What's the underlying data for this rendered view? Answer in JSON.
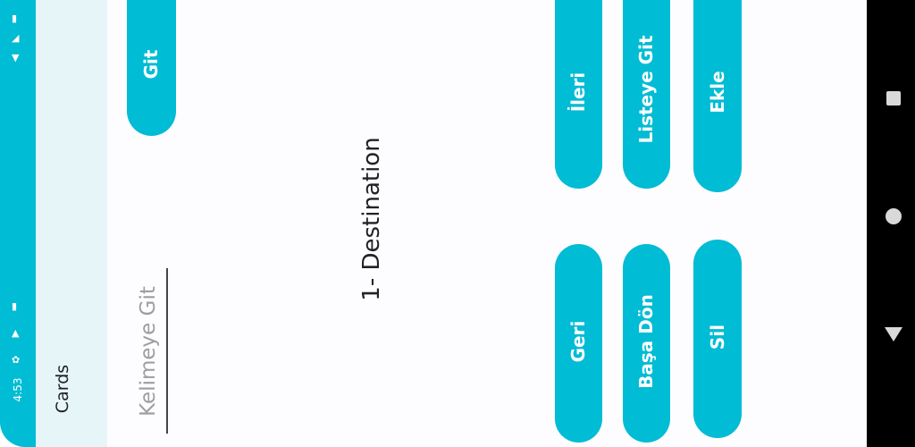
{
  "status_bar": {
    "time": "4:53",
    "icons": [
      "settings-icon",
      "alert-icon",
      "sim-card-icon",
      "battery-icon",
      "signal-icon",
      "wifi-icon"
    ]
  },
  "app_bar": {
    "title": "Cards"
  },
  "search": {
    "placeholder": "Kelimeye Git",
    "go_label": "Git"
  },
  "main": {
    "destination_label": "1- Destination"
  },
  "buttons": {
    "next": "İleri",
    "go_to_list": "Listeye Git",
    "add": "Ekle",
    "back": "Geri",
    "back_to_start": "Başa Dön",
    "delete": "Sil"
  },
  "nav_bar": {
    "icons": [
      "recents-square-icon",
      "home-circle-icon",
      "back-triangle-icon"
    ]
  },
  "colors": {
    "accent": "#00bcd4",
    "app_bar_bg": "#e6f5f8",
    "nav_bar": "#000000"
  }
}
